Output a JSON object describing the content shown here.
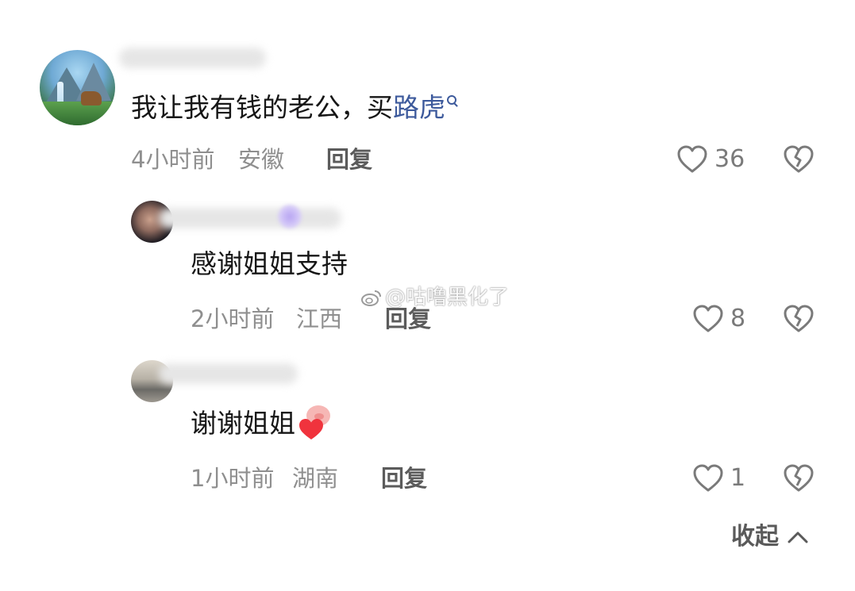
{
  "comments": [
    {
      "text_plain": "我让我有钱的老公，买",
      "link_text": "路虎",
      "time": "4小时前",
      "location": "安徽",
      "reply_label": "回复",
      "likes": "36"
    }
  ],
  "replies": [
    {
      "text": "感谢姐姐支持",
      "time": "2小时前",
      "location": "江西",
      "reply_label": "回复",
      "likes": "8"
    },
    {
      "text": "谢谢姐姐",
      "time": "1小时前",
      "location": "湖南",
      "reply_label": "回复",
      "likes": "1"
    }
  ],
  "watermark": "@咕噜黑化了",
  "collapse_label": "收起",
  "colors": {
    "link": "#3d5a9c",
    "meta": "#8f8f8f",
    "icon": "#7a7a7a"
  }
}
